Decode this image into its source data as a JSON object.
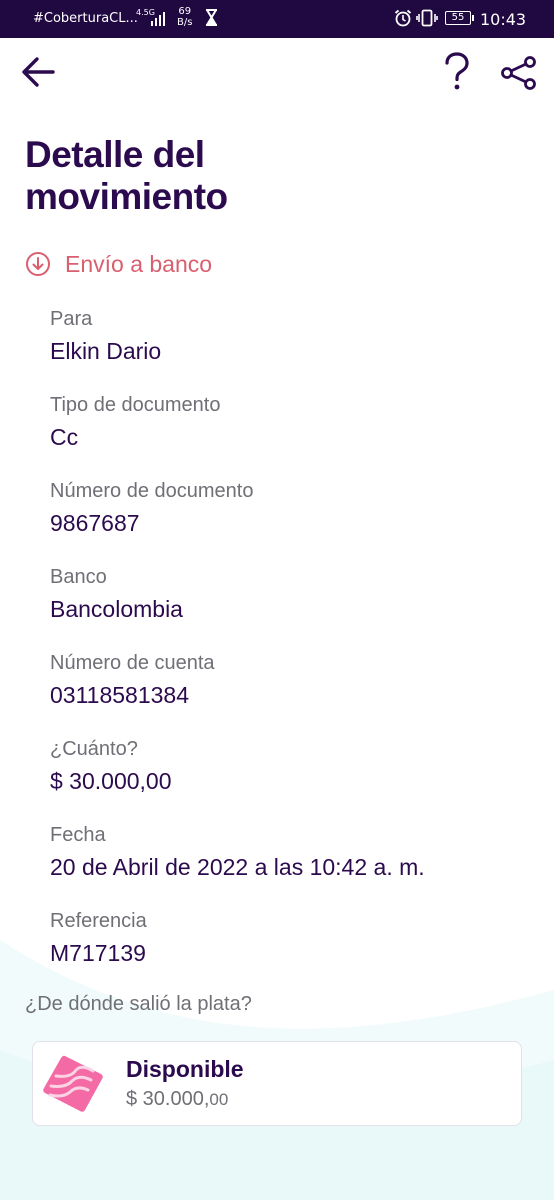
{
  "status_bar": {
    "carrier": "#CoberturaCL...",
    "network": "4.5G",
    "speed_value": "69",
    "speed_unit": "B/s",
    "battery": "55",
    "time": "10:43",
    "icons": [
      "hourglass-icon",
      "alarm-icon",
      "vibrate-icon",
      "battery-icon",
      "signal-icon"
    ]
  },
  "header": {
    "icons": [
      "back-arrow-icon",
      "help-icon",
      "share-icon"
    ],
    "title": "Detalle del movimiento"
  },
  "transaction": {
    "type": "Envío a banco",
    "type_icon": "arrow-down-circle-icon",
    "fields": [
      {
        "label": "Para",
        "value": "Elkin Dario"
      },
      {
        "label": "Tipo de documento",
        "value": "Cc"
      },
      {
        "label": "Número de documento",
        "value": "9867687"
      },
      {
        "label": "Banco",
        "value": "Bancolombia"
      },
      {
        "label": "Número de cuenta",
        "value": "03118581384"
      },
      {
        "label": "¿Cuánto?",
        "value": "$ 30.000,00"
      },
      {
        "label": "Fecha",
        "value": "20 de Abril de 2022 a las 10:42 a. m."
      },
      {
        "label": "Referencia",
        "value": "M717139"
      }
    ]
  },
  "origin": {
    "label": "¿De dónde salió la plata?",
    "account": {
      "name": "Disponible",
      "amount": "$ 30.000,",
      "amount_cents": "00",
      "icon": "pocket-icon"
    }
  },
  "colors": {
    "status_bar_bg": "#200841",
    "primary_text": "#2b0a4e",
    "accent": "#d95f6f",
    "secondary_text": "#6f6f76"
  }
}
